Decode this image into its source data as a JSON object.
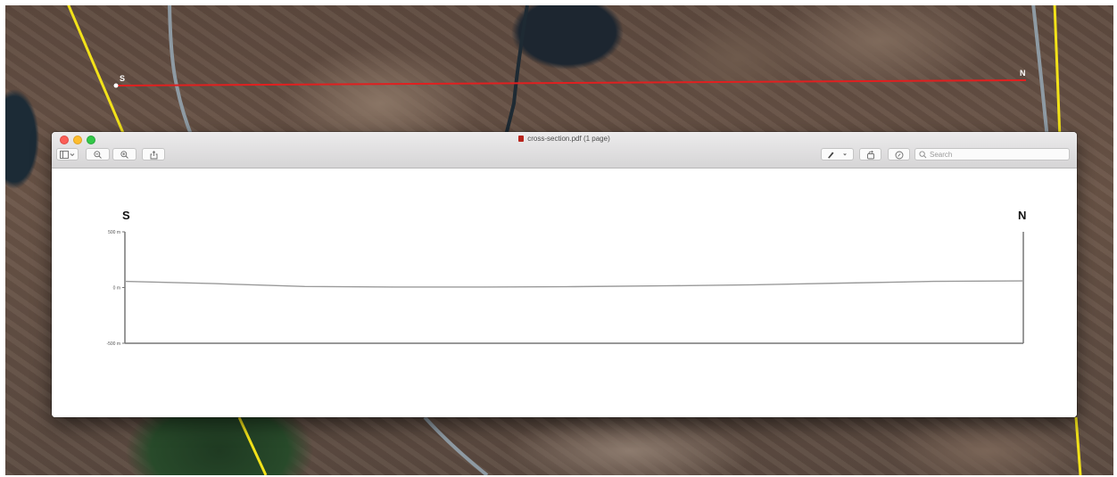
{
  "window": {
    "doc_title": "cross-section.pdf (1 page)",
    "search_placeholder": "Search"
  },
  "toolbar": {
    "left_buttons": [
      "sidebar-toggle",
      "zoom-out",
      "zoom-in",
      "share"
    ],
    "right_buttons": [
      "markup",
      "rotate",
      "annotate"
    ]
  },
  "map_labels": {
    "start": "S",
    "end": "N"
  },
  "colors": {
    "profile_line": "#e02020",
    "road": "#f2e21a"
  },
  "chart_data": {
    "type": "line",
    "title": "",
    "xlabel": "",
    "ylabel": "",
    "start_label": "S",
    "end_label": "N",
    "y_ticks": [
      "500 m",
      "0 m",
      "-500 m"
    ],
    "ylim": [
      -500,
      500
    ],
    "xlim": [
      0,
      1
    ],
    "x": [
      0.0,
      0.1,
      0.2,
      0.3,
      0.4,
      0.5,
      0.6,
      0.7,
      0.8,
      0.9,
      1.0
    ],
    "values": [
      55,
      35,
      10,
      5,
      5,
      8,
      15,
      25,
      40,
      55,
      60
    ]
  }
}
